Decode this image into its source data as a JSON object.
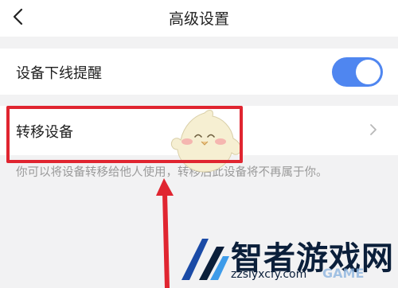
{
  "header": {
    "title": "高级设置",
    "back_icon": "chevron-left-icon"
  },
  "settings": [
    {
      "label": "设备下线提醒",
      "control": "toggle",
      "toggle_on": true,
      "toggle_color": "#4f86f0"
    },
    {
      "label": "转移设备",
      "control": "chevron",
      "chevron_icon": "chevron-right-icon"
    }
  ],
  "hint": "你可以将设备转移给他人使用，转移后此设备将不再属于你。",
  "annotation": {
    "highlight_color": "#e02530",
    "arrow_color": "#e02530"
  },
  "watermark": {
    "brand": "智者游戏网",
    "url": "zzslyxcfy.com",
    "tag": "GAME",
    "brand_color": "#0b1f3a"
  }
}
